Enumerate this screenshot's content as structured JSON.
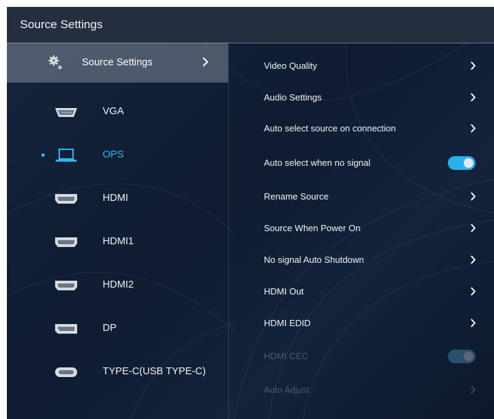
{
  "window": {
    "title": "Source Settings"
  },
  "left_panel": {
    "header": {
      "label": "Source Settings",
      "icon": "gear-icon"
    },
    "sources": [
      {
        "label": "VGA",
        "icon": "vga-port-icon",
        "active": false
      },
      {
        "label": "OPS",
        "icon": "ops-laptop-icon",
        "active": true
      },
      {
        "label": "HDMI",
        "icon": "hdmi-port-icon",
        "active": false
      },
      {
        "label": "HDMI1",
        "icon": "hdmi-port-icon",
        "active": false
      },
      {
        "label": "HDMI2",
        "icon": "hdmi-port-icon",
        "active": false
      },
      {
        "label": "DP",
        "icon": "displayport-icon",
        "active": false
      },
      {
        "label": "TYPE-C(USB TYPE-C)",
        "icon": "usb-c-port-icon",
        "active": false
      }
    ]
  },
  "right_panel": {
    "settings": [
      {
        "label": "Video Quality",
        "control": "chevron",
        "enabled": true
      },
      {
        "label": "Audio Settings",
        "control": "chevron",
        "enabled": true
      },
      {
        "label": "Auto select source on connection",
        "control": "chevron",
        "enabled": true
      },
      {
        "label": "Auto select when no signal",
        "control": "toggle",
        "toggle_on": true,
        "enabled": true
      },
      {
        "label": "Rename Source",
        "control": "chevron",
        "enabled": true
      },
      {
        "label": "Source When Power On",
        "control": "chevron",
        "enabled": true
      },
      {
        "label": "No signal Auto Shutdown",
        "control": "chevron",
        "enabled": true
      },
      {
        "label": "HDMI Out",
        "control": "chevron",
        "enabled": true
      },
      {
        "label": "HDMI EDID",
        "control": "chevron",
        "enabled": true
      },
      {
        "label": "HDMI CEC",
        "control": "toggle",
        "toggle_on": true,
        "enabled": false
      },
      {
        "label": "Auto Adjust",
        "control": "chevron",
        "enabled": false
      }
    ]
  },
  "colors": {
    "accent": "#29b9f0",
    "background": "#13213a",
    "text": "#f2f4f7",
    "disabled_text": "#4c5a70"
  }
}
